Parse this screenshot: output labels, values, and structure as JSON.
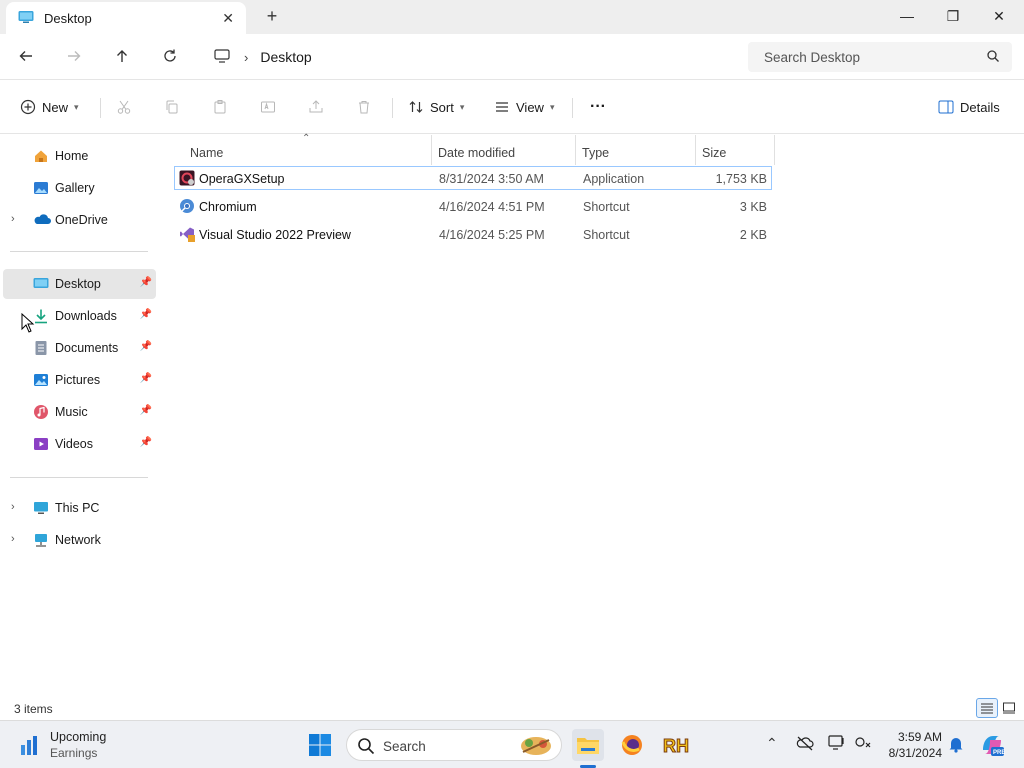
{
  "window": {
    "tab_title": "Desktop",
    "new_tab": "+",
    "controls": {
      "minimize": "—",
      "maximize": "❐",
      "close": "✕"
    }
  },
  "address": {
    "crumb": "Desktop",
    "search_placeholder": "Search Desktop"
  },
  "toolbar": {
    "new_label": "New",
    "sort_label": "Sort",
    "view_label": "View",
    "more_label": "···",
    "details_label": "Details"
  },
  "sidebar": {
    "top": [
      {
        "label": "Home",
        "icon": "home-icon"
      },
      {
        "label": "Gallery",
        "icon": "gallery-icon"
      },
      {
        "label": "OneDrive",
        "icon": "onedrive-icon"
      }
    ],
    "pinned": [
      {
        "label": "Desktop",
        "icon": "desktop-folder-icon",
        "selected": true
      },
      {
        "label": "Downloads",
        "icon": "downloads-icon"
      },
      {
        "label": "Documents",
        "icon": "documents-icon"
      },
      {
        "label": "Pictures",
        "icon": "pictures-icon"
      },
      {
        "label": "Music",
        "icon": "music-icon"
      },
      {
        "label": "Videos",
        "icon": "videos-icon"
      }
    ],
    "bottom": [
      {
        "label": "This PC",
        "icon": "this-pc-icon"
      },
      {
        "label": "Network",
        "icon": "network-icon"
      }
    ]
  },
  "files": {
    "columns": [
      "Name",
      "Date modified",
      "Type",
      "Size"
    ],
    "sorted_column": "Name",
    "rows": [
      {
        "name": "OperaGXSetup",
        "date": "8/31/2024 3:50 AM",
        "type": "Application",
        "size": "1,753 KB",
        "icon": "opera-gx-icon",
        "selected": true
      },
      {
        "name": "Chromium",
        "date": "4/16/2024 4:51 PM",
        "type": "Shortcut",
        "size": "3 KB",
        "icon": "chromium-icon"
      },
      {
        "name": "Visual Studio 2022 Preview",
        "date": "4/16/2024 5:25 PM",
        "type": "Shortcut",
        "size": "2 KB",
        "icon": "visual-studio-icon"
      }
    ]
  },
  "status": {
    "item_count": "3 items"
  },
  "taskbar": {
    "widget_title": "Upcoming",
    "widget_subtitle": "Earnings",
    "search_label": "Search",
    "time": "3:59 AM",
    "date": "8/31/2024",
    "accent": "#1f6fd1"
  }
}
